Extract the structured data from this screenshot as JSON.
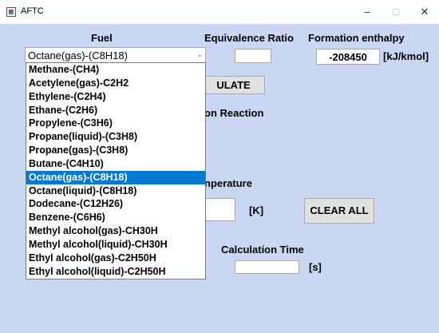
{
  "window": {
    "title": "AFTC",
    "minimize_glyph": "–",
    "maximize_glyph": "□",
    "close_glyph": "✕"
  },
  "labels": {
    "fuel": "Fuel",
    "equivalence_ratio": "Equivalence Ratio",
    "formation_enthalpy": "Formation enthalpy",
    "enthalpy_unit": "[kJ/kmol]",
    "reaction_fragment": "on Reaction",
    "temperature_fragment": "nperature",
    "temp_unit": "[K]",
    "calculation_time": "Calculation Time",
    "time_unit": "[s]"
  },
  "fields": {
    "equivalence_ratio": "",
    "formation_enthalpy": "-208450",
    "temperature": "",
    "calculation_time": ""
  },
  "buttons": {
    "calculate_fragment": "ULATE",
    "clear_all": "CLEAR ALL"
  },
  "fuel_select": {
    "selected": "Octane(gas)-(C8H18)",
    "selected_index": 8,
    "options": [
      "Methane-(CH4)",
      "Acetylene(gas)-C2H2",
      "Ethylene-(C2H4)",
      "Ethane-(C2H6)",
      "Propylene-(C3H6)",
      "Propane(liquid)-(C3H8)",
      "Propane(gas)-(C3H8)",
      "Butane-(C4H10)",
      "Octane(gas)-(C8H18)",
      "Octane(liquid)-(C8H18)",
      "Dodecane-(C12H26)",
      "Benzene-(C6H6)",
      "Methyl alcohol(gas)-CH30H",
      "Methyl alcohol(liquid)-CH30H",
      "Ethyl alcohol(gas)-C2H50H",
      "Ethyl alcohol(liquid)-C2H50H"
    ]
  },
  "colors": {
    "client_background": "#c9d7f3",
    "selection": "#0078d7"
  }
}
